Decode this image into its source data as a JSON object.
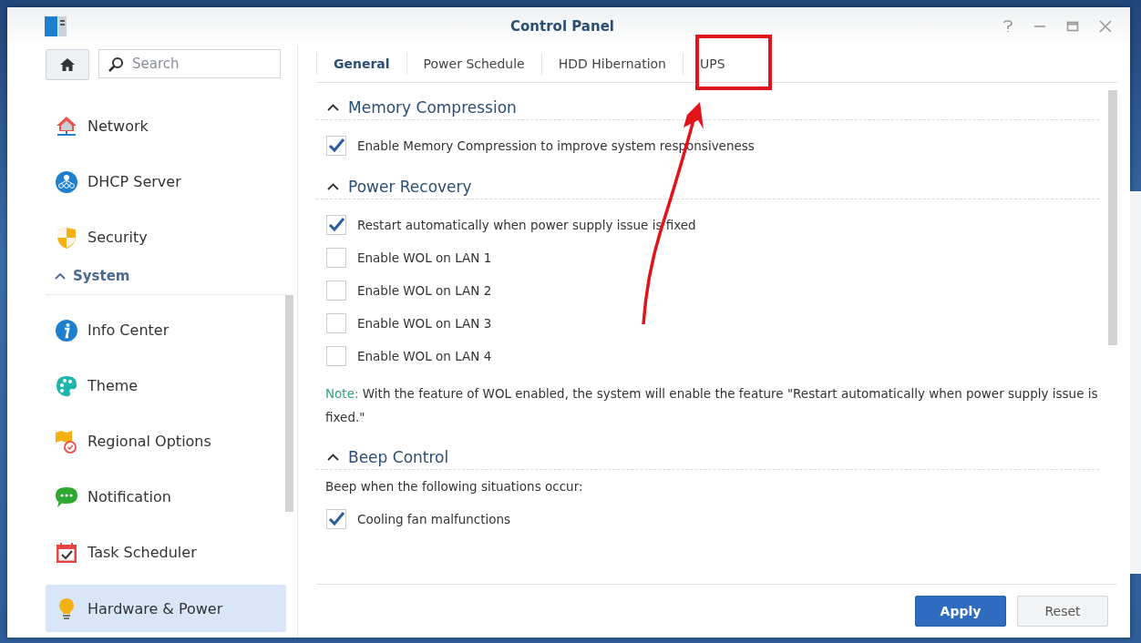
{
  "window": {
    "title": "Control Panel"
  },
  "sidebar": {
    "search": {
      "placeholder": "Search"
    },
    "items": [
      {
        "kind": "item",
        "label": "Network",
        "selected": false
      },
      {
        "kind": "item",
        "label": "DHCP Server",
        "selected": false
      },
      {
        "kind": "item",
        "label": "Security",
        "selected": false
      },
      {
        "kind": "header",
        "label": "System",
        "expanded": true
      },
      {
        "kind": "item",
        "label": "Info Center",
        "selected": false
      },
      {
        "kind": "item",
        "label": "Theme",
        "selected": false
      },
      {
        "kind": "item",
        "label": "Regional Options",
        "selected": false
      },
      {
        "kind": "item",
        "label": "Notification",
        "selected": false
      },
      {
        "kind": "item",
        "label": "Task Scheduler",
        "selected": false
      },
      {
        "kind": "item",
        "label": "Hardware & Power",
        "selected": true
      }
    ]
  },
  "tabs": [
    {
      "label": "General",
      "selected": true
    },
    {
      "label": "Power Schedule",
      "selected": false
    },
    {
      "label": "HDD Hibernation",
      "selected": false
    },
    {
      "label": "UPS",
      "selected": false
    }
  ],
  "sections": [
    {
      "title": "Memory Compression",
      "expanded": true,
      "items": [
        {
          "kind": "checkbox",
          "label": "Enable Memory Compression to improve system responsiveness",
          "checked": true
        }
      ]
    },
    {
      "title": "Power Recovery",
      "expanded": true,
      "items": [
        {
          "kind": "checkbox",
          "label": "Restart automatically when power supply issue is fixed",
          "checked": true
        },
        {
          "kind": "checkbox",
          "label": "Enable WOL on LAN 1",
          "checked": false
        },
        {
          "kind": "checkbox",
          "label": "Enable WOL on LAN 2",
          "checked": false
        },
        {
          "kind": "checkbox",
          "label": "Enable WOL on LAN 3",
          "checked": false
        },
        {
          "kind": "checkbox",
          "label": "Enable WOL on LAN 4",
          "checked": false
        },
        {
          "kind": "note",
          "label": "Note:",
          "text": "With the feature of WOL enabled, the system will enable the feature \"Restart automatically when power supply issue is fixed.\""
        }
      ]
    },
    {
      "title": "Beep Control",
      "expanded": true,
      "items": [
        {
          "kind": "text",
          "label": "Beep when the following situations occur:"
        },
        {
          "kind": "checkbox",
          "label": "Cooling fan malfunctions",
          "checked": true
        }
      ]
    }
  ],
  "buttons": [
    {
      "label": "Apply",
      "kind": "primary"
    },
    {
      "label": "Reset",
      "kind": "secondary"
    }
  ]
}
